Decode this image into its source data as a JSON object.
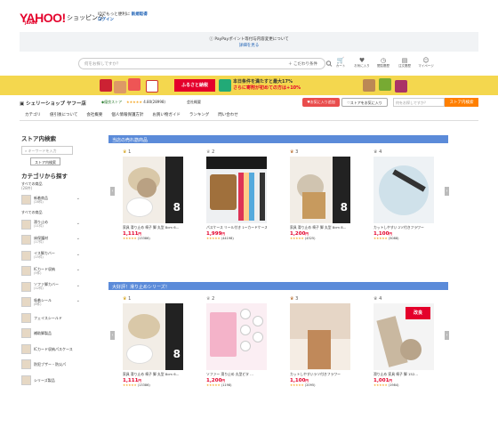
{
  "header": {
    "logo_main": "YAHOO!",
    "logo_sub": "JAPAN",
    "shopping_label": "ショッピング",
    "link_line1": "IDでもっと便利に",
    "link_register": "新規取得",
    "link_login": "ログイン"
  },
  "notice": {
    "line1": "PayPayポイント等付与内容変更について",
    "line2": "詳細を見る"
  },
  "search": {
    "placeholder": "何をお探しですか？",
    "condition_label": "＋ こだわり条件"
  },
  "header_icons": [
    {
      "label": "カート",
      "icon": "cart-icon"
    },
    {
      "label": "お気に入り",
      "icon": "heart-icon"
    },
    {
      "label": "閲覧履歴",
      "icon": "history-icon"
    },
    {
      "label": "注文履歴",
      "icon": "order-icon"
    },
    {
      "label": "マイページ",
      "icon": "user-icon"
    }
  ],
  "banner": {
    "furusato": "ふるさと納税",
    "text1": "本日条件を満たすと最大17%",
    "text2": "さらに寄附が初めての方は+10%"
  },
  "store": {
    "name": "シェリーショップ ヤフー店",
    "badge": "優良ストア",
    "rating": "4.80",
    "review_count": "(28998)",
    "company_label": "会社概要",
    "fav_button": "お気に入り追加",
    "add_button": "ストアをお気に入り",
    "search_placeholder": "何をお探しですか？",
    "search_button": "ストア内検索"
  },
  "nav": [
    "カテゴリ",
    "値引後について",
    "会社概要",
    "個人情報保護方針",
    "お買い物ガイド",
    "ランキング",
    "問い合わせ"
  ],
  "sidebar": {
    "search_title": "ストア内検索",
    "search_placeholder": "キーワードを入力",
    "search_button": "ストア内検索",
    "category_title": "カテゴリから探す",
    "all_label": "すべての商品",
    "all_count": "(28件)",
    "items": [
      {
        "label": "新着商品",
        "count": "(28件)"
      },
      {
        "label": "すべての商品",
        "count": ""
      },
      {
        "label": "滑り止め",
        "count": "(11件)"
      },
      {
        "label": "床保護材",
        "count": "(17件)"
      },
      {
        "label": "イス脚カバー",
        "count": "(15件)"
      },
      {
        "label": "ICカード収納",
        "count": "(5件)"
      },
      {
        "label": "ソファ脚カバー",
        "count": "(12件)"
      },
      {
        "label": "吸着シール",
        "count": "(8件)"
      }
    ],
    "plain_items": [
      "フェイスシールド",
      "補助脚製品",
      "ICカード収納パスケース",
      "防犯ブザー・防災パ",
      "シリーズ製品"
    ]
  },
  "sections": [
    {
      "title": "当店の売れ筋商品",
      "products": [
        {
          "rank": "1",
          "name": "家具 滑り止め 椅子 脚 丸型 8cm 6…",
          "price": "1,111",
          "reviews": "(13386)"
        },
        {
          "rank": "2",
          "name": "パスケース リール付き 1ーカードケース",
          "price": "1,999",
          "reviews": "(44198)"
        },
        {
          "rank": "3",
          "name": "家具 滑り止め 椅子 脚 丸型 8cm 8…",
          "price": "1,200",
          "reviews": "(4325)"
        },
        {
          "rank": "4",
          "name": "カットしやすい 2ソ付きフラワー",
          "price": "1,100",
          "reviews": "(5088)"
        }
      ]
    },
    {
      "title": "大好評！滑り止めシリーズ！",
      "products": [
        {
          "rank": "1",
          "name": "家具 滑り止め 椅子 脚 丸型 8cm 6…",
          "price": "1,111",
          "reviews": "(13386)"
        },
        {
          "rank": "2",
          "name": "ソファー 滑り止め 丸型ピタ …",
          "price": "1,200",
          "reviews": "(1198)"
        },
        {
          "rank": "3",
          "name": "カットしやすいラソ付きフラワー",
          "price": "1,100",
          "reviews": "(2095)"
        },
        {
          "rank": "4",
          "name": "滑り止め 家具 椅子 脚 152…",
          "price": "1,001",
          "reviews": "(1984)"
        }
      ]
    }
  ],
  "currency": "円",
  "stars": "★★★★★",
  "colors": {
    "accent_red": "#e4002b",
    "section_blue": "#5b8bd9",
    "banner_yellow": "#f4d74e"
  }
}
